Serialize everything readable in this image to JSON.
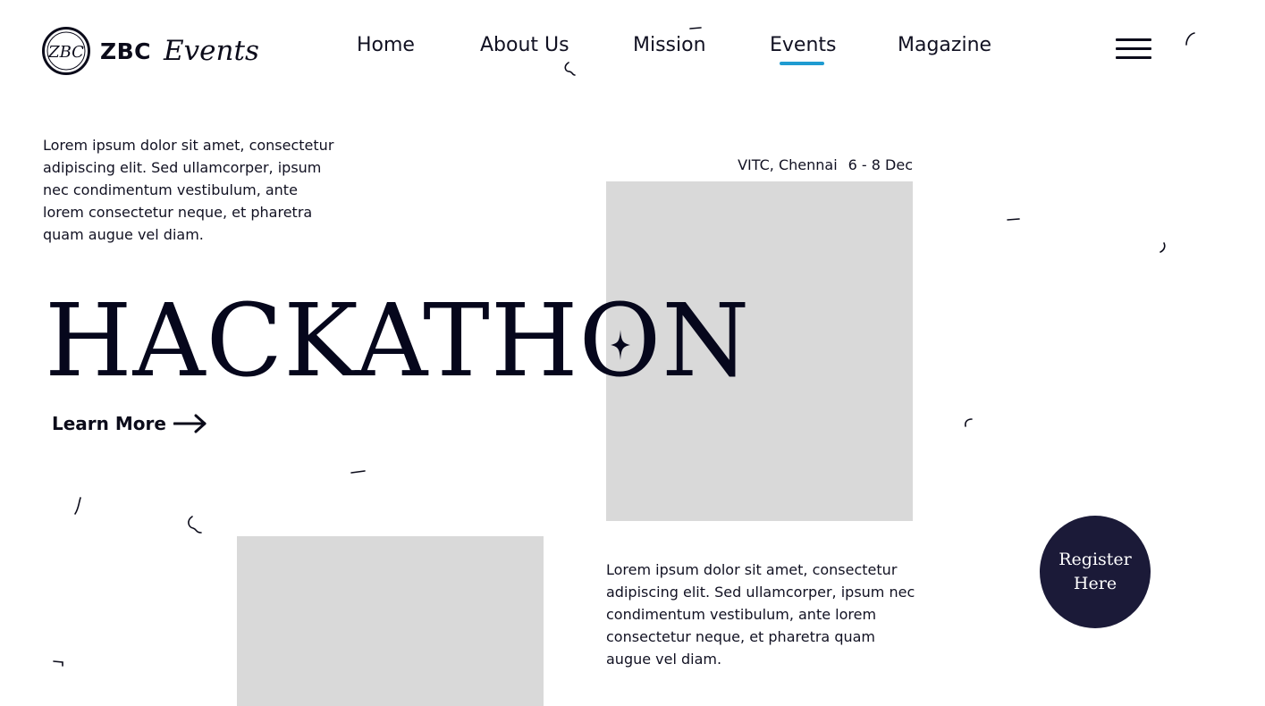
{
  "header": {
    "brand_bold": "ZBC",
    "brand_script": "Events",
    "logo_monogram": "ZBC",
    "nav": {
      "home": "Home",
      "about": "About Us",
      "mission": "Mission",
      "events": "Events",
      "magazine": "Magazine"
    },
    "active_nav": "Events",
    "accent_color": "#1f9bd1"
  },
  "intro": {
    "text": "Lorem ipsum dolor sit amet, consectetur adipiscing elit. Sed ullamcorper, ipsum nec condimentum vestibulum, ante lorem consectetur neque, et pharetra quam augue vel diam."
  },
  "event": {
    "location": "VITC, Chennai",
    "dates": "6 - 8 Dec",
    "title_part1": "HACKATH",
    "title_o": "O",
    "title_part2": "N",
    "learn_more": "Learn More",
    "description": "Lorem ipsum dolor sit amet, consectetur adipiscing elit. Sed ullamcorper, ipsum nec condimentum vestibulum, ante lorem consectetur neque, et pharetra quam augue vel diam."
  },
  "register": {
    "label": "Register Here",
    "color": "#1b1a38"
  },
  "icons": {
    "logo": "zbc-logo-icon",
    "menu": "hamburger-menu-icon",
    "arrow": "arrow-right-icon",
    "star": "four-point-star-icon"
  }
}
